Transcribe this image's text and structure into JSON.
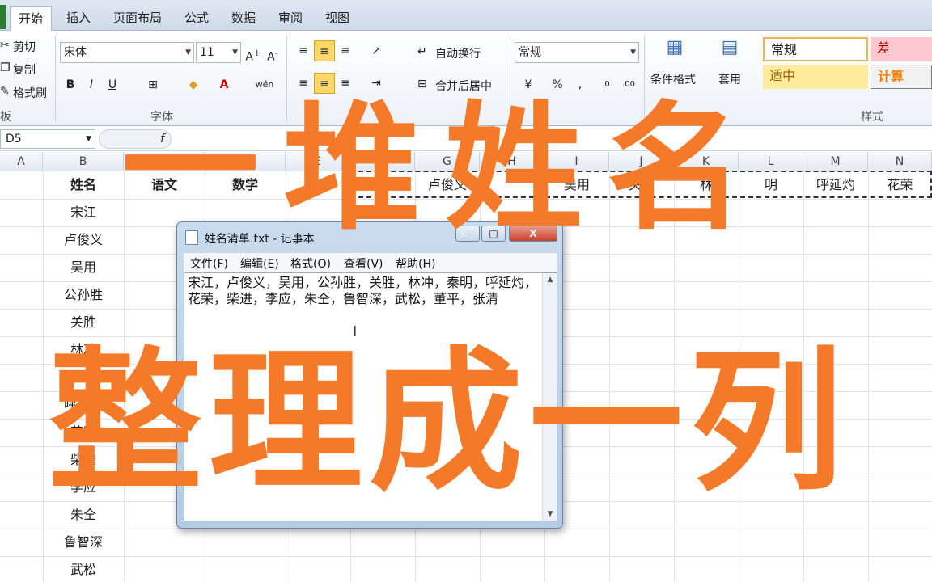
{
  "ribbon_tabs": [
    "开始",
    "插入",
    "页面布局",
    "公式",
    "数据",
    "审阅",
    "视图"
  ],
  "clipboard": {
    "cut": "剪切",
    "copy": "复制",
    "format_painter": "格式刷",
    "group_label": "板"
  },
  "font": {
    "name": "宋体",
    "size": "11",
    "group_label": "字体",
    "bold": "B",
    "italic": "I",
    "underline": "U",
    "font_color_glyph": "A",
    "wen_glyph": "wén"
  },
  "alignment": {
    "wrap_text": "自动换行",
    "merge_center": "合并后居中"
  },
  "number": {
    "format": "常规",
    "percent": "%"
  },
  "styles": {
    "conditional_format": "条件格式",
    "table_format": "套用",
    "normal": "常规",
    "bad": "差",
    "neutral": "适中",
    "calculation": "计算",
    "group_label": "样式"
  },
  "formula_bar": {
    "name_box": "D5",
    "fx": "f"
  },
  "columns": [
    "A",
    "B",
    "C",
    "D",
    "E",
    "F",
    "G",
    "H",
    "I",
    "J",
    "K",
    "L",
    "M",
    "N"
  ],
  "column_b_cells": [
    "姓名",
    "宋江",
    "卢俊义",
    "吴用",
    "公孙胜",
    "关胜",
    "林冲",
    "呼延灼",
    "花荣",
    "柴进",
    "李应",
    "朱仝",
    "鲁智深",
    "武松"
  ],
  "header_cells": {
    "c": "语文",
    "d": "数学"
  },
  "row1_right": [
    "卢俊义",
    "吴用",
    "关胜",
    "林",
    "明",
    "呼延灼",
    "花荣"
  ],
  "notepad": {
    "title": "姓名清单.txt - 记事本",
    "minimize": "—",
    "maximize": "□",
    "close": "X",
    "menu": [
      "文件(F)",
      "编辑(E)",
      "格式(O)",
      "查看(V)",
      "帮助(H)"
    ],
    "content": "宋江，卢俊义，吴用，公孙胜，关胜，林冲，秦明，呼延灼，花荣，柴进，李应，朱仝，鲁智深，武松，董平，张清"
  },
  "overlay": {
    "line1": "一堆姓名",
    "line2": "整理成一列"
  },
  "colors": {
    "accent": "#f47a2a",
    "ribbon_bg": "#dfe7f1",
    "highlight": "#fcd86a"
  }
}
